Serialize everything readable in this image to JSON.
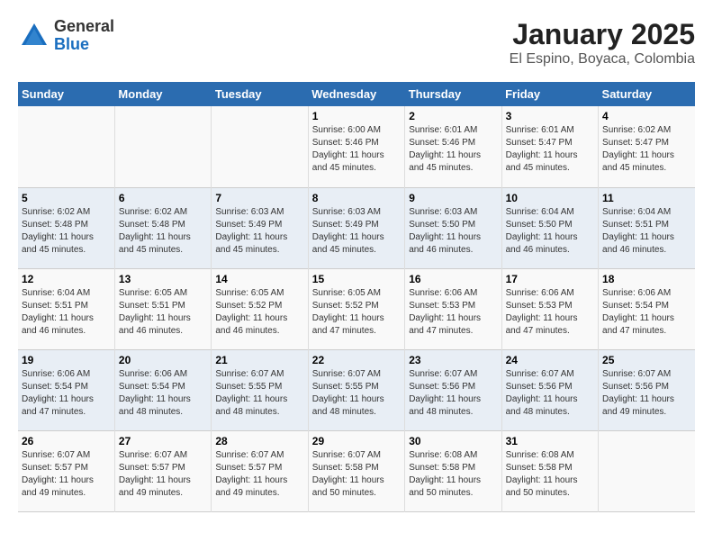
{
  "logo": {
    "general": "General",
    "blue": "Blue"
  },
  "title": "January 2025",
  "subtitle": "El Espino, Boyaca, Colombia",
  "days_of_week": [
    "Sunday",
    "Monday",
    "Tuesday",
    "Wednesday",
    "Thursday",
    "Friday",
    "Saturday"
  ],
  "weeks": [
    [
      {
        "day": "",
        "info": ""
      },
      {
        "day": "",
        "info": ""
      },
      {
        "day": "",
        "info": ""
      },
      {
        "day": "1",
        "info": "Sunrise: 6:00 AM\nSunset: 5:46 PM\nDaylight: 11 hours\nand 45 minutes."
      },
      {
        "day": "2",
        "info": "Sunrise: 6:01 AM\nSunset: 5:46 PM\nDaylight: 11 hours\nand 45 minutes."
      },
      {
        "day": "3",
        "info": "Sunrise: 6:01 AM\nSunset: 5:47 PM\nDaylight: 11 hours\nand 45 minutes."
      },
      {
        "day": "4",
        "info": "Sunrise: 6:02 AM\nSunset: 5:47 PM\nDaylight: 11 hours\nand 45 minutes."
      }
    ],
    [
      {
        "day": "5",
        "info": "Sunrise: 6:02 AM\nSunset: 5:48 PM\nDaylight: 11 hours\nand 45 minutes."
      },
      {
        "day": "6",
        "info": "Sunrise: 6:02 AM\nSunset: 5:48 PM\nDaylight: 11 hours\nand 45 minutes."
      },
      {
        "day": "7",
        "info": "Sunrise: 6:03 AM\nSunset: 5:49 PM\nDaylight: 11 hours\nand 45 minutes."
      },
      {
        "day": "8",
        "info": "Sunrise: 6:03 AM\nSunset: 5:49 PM\nDaylight: 11 hours\nand 45 minutes."
      },
      {
        "day": "9",
        "info": "Sunrise: 6:03 AM\nSunset: 5:50 PM\nDaylight: 11 hours\nand 46 minutes."
      },
      {
        "day": "10",
        "info": "Sunrise: 6:04 AM\nSunset: 5:50 PM\nDaylight: 11 hours\nand 46 minutes."
      },
      {
        "day": "11",
        "info": "Sunrise: 6:04 AM\nSunset: 5:51 PM\nDaylight: 11 hours\nand 46 minutes."
      }
    ],
    [
      {
        "day": "12",
        "info": "Sunrise: 6:04 AM\nSunset: 5:51 PM\nDaylight: 11 hours\nand 46 minutes."
      },
      {
        "day": "13",
        "info": "Sunrise: 6:05 AM\nSunset: 5:51 PM\nDaylight: 11 hours\nand 46 minutes."
      },
      {
        "day": "14",
        "info": "Sunrise: 6:05 AM\nSunset: 5:52 PM\nDaylight: 11 hours\nand 46 minutes."
      },
      {
        "day": "15",
        "info": "Sunrise: 6:05 AM\nSunset: 5:52 PM\nDaylight: 11 hours\nand 47 minutes."
      },
      {
        "day": "16",
        "info": "Sunrise: 6:06 AM\nSunset: 5:53 PM\nDaylight: 11 hours\nand 47 minutes."
      },
      {
        "day": "17",
        "info": "Sunrise: 6:06 AM\nSunset: 5:53 PM\nDaylight: 11 hours\nand 47 minutes."
      },
      {
        "day": "18",
        "info": "Sunrise: 6:06 AM\nSunset: 5:54 PM\nDaylight: 11 hours\nand 47 minutes."
      }
    ],
    [
      {
        "day": "19",
        "info": "Sunrise: 6:06 AM\nSunset: 5:54 PM\nDaylight: 11 hours\nand 47 minutes."
      },
      {
        "day": "20",
        "info": "Sunrise: 6:06 AM\nSunset: 5:54 PM\nDaylight: 11 hours\nand 48 minutes."
      },
      {
        "day": "21",
        "info": "Sunrise: 6:07 AM\nSunset: 5:55 PM\nDaylight: 11 hours\nand 48 minutes."
      },
      {
        "day": "22",
        "info": "Sunrise: 6:07 AM\nSunset: 5:55 PM\nDaylight: 11 hours\nand 48 minutes."
      },
      {
        "day": "23",
        "info": "Sunrise: 6:07 AM\nSunset: 5:56 PM\nDaylight: 11 hours\nand 48 minutes."
      },
      {
        "day": "24",
        "info": "Sunrise: 6:07 AM\nSunset: 5:56 PM\nDaylight: 11 hours\nand 48 minutes."
      },
      {
        "day": "25",
        "info": "Sunrise: 6:07 AM\nSunset: 5:56 PM\nDaylight: 11 hours\nand 49 minutes."
      }
    ],
    [
      {
        "day": "26",
        "info": "Sunrise: 6:07 AM\nSunset: 5:57 PM\nDaylight: 11 hours\nand 49 minutes."
      },
      {
        "day": "27",
        "info": "Sunrise: 6:07 AM\nSunset: 5:57 PM\nDaylight: 11 hours\nand 49 minutes."
      },
      {
        "day": "28",
        "info": "Sunrise: 6:07 AM\nSunset: 5:57 PM\nDaylight: 11 hours\nand 49 minutes."
      },
      {
        "day": "29",
        "info": "Sunrise: 6:07 AM\nSunset: 5:58 PM\nDaylight: 11 hours\nand 50 minutes."
      },
      {
        "day": "30",
        "info": "Sunrise: 6:08 AM\nSunset: 5:58 PM\nDaylight: 11 hours\nand 50 minutes."
      },
      {
        "day": "31",
        "info": "Sunrise: 6:08 AM\nSunset: 5:58 PM\nDaylight: 11 hours\nand 50 minutes."
      },
      {
        "day": "",
        "info": ""
      }
    ]
  ]
}
